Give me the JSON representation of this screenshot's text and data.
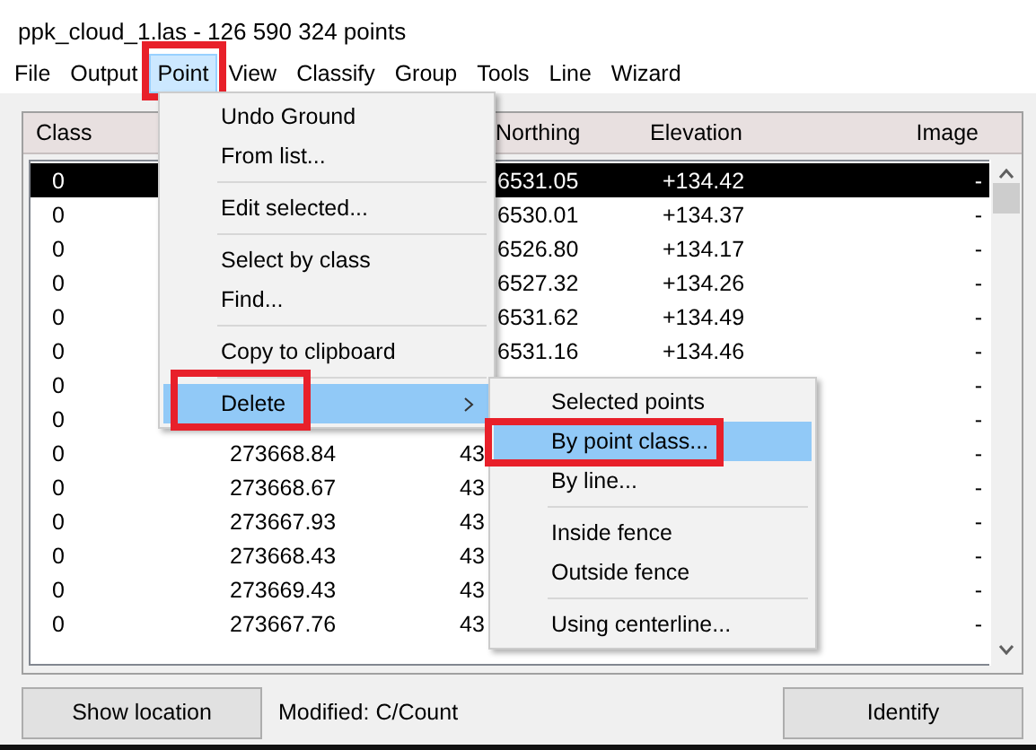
{
  "window": {
    "title": "ppk_cloud_1.las - 126 590 324 points"
  },
  "menubar": [
    {
      "label": "File",
      "selected": false,
      "annotated": false
    },
    {
      "label": "Output",
      "selected": false,
      "annotated": false
    },
    {
      "label": "Point",
      "selected": true,
      "annotated": true
    },
    {
      "label": "View",
      "selected": false,
      "annotated": false
    },
    {
      "label": "Classify",
      "selected": false,
      "annotated": false
    },
    {
      "label": "Group",
      "selected": false,
      "annotated": false
    },
    {
      "label": "Tools",
      "selected": false,
      "annotated": false
    },
    {
      "label": "Line",
      "selected": false,
      "annotated": false
    },
    {
      "label": "Wizard",
      "selected": false,
      "annotated": false
    }
  ],
  "table": {
    "columns": [
      "Class",
      "Northing",
      "Elevation",
      "Image"
    ],
    "rows": [
      {
        "kind": "menu-covered",
        "selected": true,
        "class": "0",
        "northing": "6531.05",
        "elevation": "+134.42",
        "image": "-"
      },
      {
        "kind": "menu-covered",
        "selected": false,
        "class": "0",
        "northing": "6530.01",
        "elevation": "+134.37",
        "image": "-"
      },
      {
        "kind": "menu-covered",
        "selected": false,
        "class": "0",
        "northing": "6526.80",
        "elevation": "+134.17",
        "image": "-"
      },
      {
        "kind": "menu-covered",
        "selected": false,
        "class": "0",
        "northing": "6527.32",
        "elevation": "+134.26",
        "image": "-"
      },
      {
        "kind": "menu-covered",
        "selected": false,
        "class": "0",
        "northing": "6531.62",
        "elevation": "+134.49",
        "image": "-"
      },
      {
        "kind": "menu-covered",
        "selected": false,
        "class": "0",
        "northing": "6531.16",
        "elevation": "+134.46",
        "image": "-"
      },
      {
        "kind": "both-covered",
        "selected": false,
        "class": "0",
        "image": "-"
      },
      {
        "kind": "both-covered",
        "selected": false,
        "class": "0",
        "image": "-"
      },
      {
        "kind": "submenu-covered",
        "selected": false,
        "class": "0",
        "easting": "273668.84",
        "northing": "43",
        "image": "-"
      },
      {
        "kind": "submenu-covered",
        "selected": false,
        "class": "0",
        "easting": "273668.67",
        "northing": "43",
        "image": "-"
      },
      {
        "kind": "submenu-covered",
        "selected": false,
        "class": "0",
        "easting": "273667.93",
        "northing": "43",
        "image": "-"
      },
      {
        "kind": "submenu-covered",
        "selected": false,
        "class": "0",
        "easting": "273668.43",
        "northing": "43",
        "image": "-"
      },
      {
        "kind": "submenu-covered",
        "selected": false,
        "class": "0",
        "easting": "273669.43",
        "northing": "43",
        "image": "-"
      },
      {
        "kind": "submenu-covered",
        "selected": false,
        "class": "0",
        "easting": "273667.76",
        "northing": "43",
        "image": "-"
      }
    ]
  },
  "menu": {
    "items": [
      {
        "kind": "item",
        "label": "Undo Ground",
        "highlighted": false,
        "annotated": false
      },
      {
        "kind": "item",
        "label": "From list...",
        "highlighted": false,
        "annotated": false
      },
      {
        "kind": "separator"
      },
      {
        "kind": "item",
        "label": "Edit selected...",
        "highlighted": false,
        "annotated": false
      },
      {
        "kind": "separator"
      },
      {
        "kind": "item",
        "label": "Select by class",
        "highlighted": false,
        "annotated": false
      },
      {
        "kind": "item",
        "label": "Find...",
        "highlighted": false,
        "annotated": false
      },
      {
        "kind": "separator"
      },
      {
        "kind": "item",
        "label": "Copy to clipboard",
        "highlighted": false,
        "annotated": false
      },
      {
        "kind": "separator"
      },
      {
        "kind": "submenu",
        "label": "Delete",
        "highlighted": true,
        "annotated": true
      }
    ]
  },
  "submenu": {
    "items": [
      {
        "kind": "item",
        "label": "Selected points",
        "highlighted": false,
        "annotated": false
      },
      {
        "kind": "item",
        "label": "By point class...",
        "highlighted": true,
        "annotated": true
      },
      {
        "kind": "item",
        "label": "By line...",
        "highlighted": false,
        "annotated": false
      },
      {
        "kind": "separator"
      },
      {
        "kind": "item",
        "label": "Inside fence",
        "highlighted": false,
        "annotated": false
      },
      {
        "kind": "item",
        "label": "Outside fence",
        "highlighted": false,
        "annotated": false
      },
      {
        "kind": "separator"
      },
      {
        "kind": "item",
        "label": "Using centerline...",
        "highlighted": false,
        "annotated": false
      }
    ]
  },
  "footer": {
    "left_button": "Show location",
    "status": "Modified: C/Count",
    "right_button": "Identify"
  }
}
